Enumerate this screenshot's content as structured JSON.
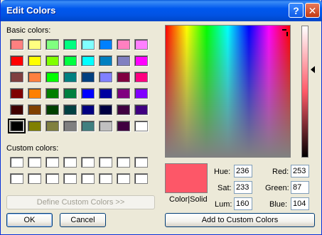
{
  "window": {
    "title": "Edit Colors",
    "help_glyph": "?",
    "close_glyph": "✕"
  },
  "basic_colors": {
    "label": "Basic colors:",
    "colors": [
      [
        "#ff8080",
        "#ffff80",
        "#80ff80",
        "#00ff80",
        "#80ffff",
        "#0080ff",
        "#ff80c0",
        "#ff80ff"
      ],
      [
        "#ff0000",
        "#ffff00",
        "#80ff00",
        "#00ff40",
        "#00ffff",
        "#0080c0",
        "#8080c0",
        "#ff00ff"
      ],
      [
        "#804040",
        "#ff8040",
        "#00ff00",
        "#008080",
        "#004080",
        "#8080ff",
        "#800040",
        "#ff0080"
      ],
      [
        "#800000",
        "#ff8000",
        "#008000",
        "#008040",
        "#0000ff",
        "#0000a0",
        "#800080",
        "#8000ff"
      ],
      [
        "#400000",
        "#804000",
        "#004000",
        "#004040",
        "#000080",
        "#000040",
        "#400040",
        "#400080"
      ],
      [
        "#000000",
        "#808000",
        "#808040",
        "#808080",
        "#408080",
        "#c0c0c0",
        "#400040",
        "#ffffff"
      ]
    ],
    "selected": [
      5,
      0
    ]
  },
  "custom_colors": {
    "label": "Custom colors:",
    "count": 16,
    "color": "#ffffff"
  },
  "buttons": {
    "define_custom": "Define Custom Colors >>",
    "ok": "OK",
    "cancel": "Cancel",
    "add_custom": "Add to Custom Colors"
  },
  "preview": {
    "label": "Color|Solid",
    "color": "#fd5768"
  },
  "fields": {
    "hue": {
      "label": "Hue:",
      "value": "236"
    },
    "sat": {
      "label": "Sat:",
      "value": "233"
    },
    "lum": {
      "label": "Lum:",
      "value": "160"
    },
    "red": {
      "label": "Red:",
      "value": "253"
    },
    "green": {
      "label": "Green:",
      "value": "87"
    },
    "blue": {
      "label": "Blue:",
      "value": "104"
    }
  }
}
